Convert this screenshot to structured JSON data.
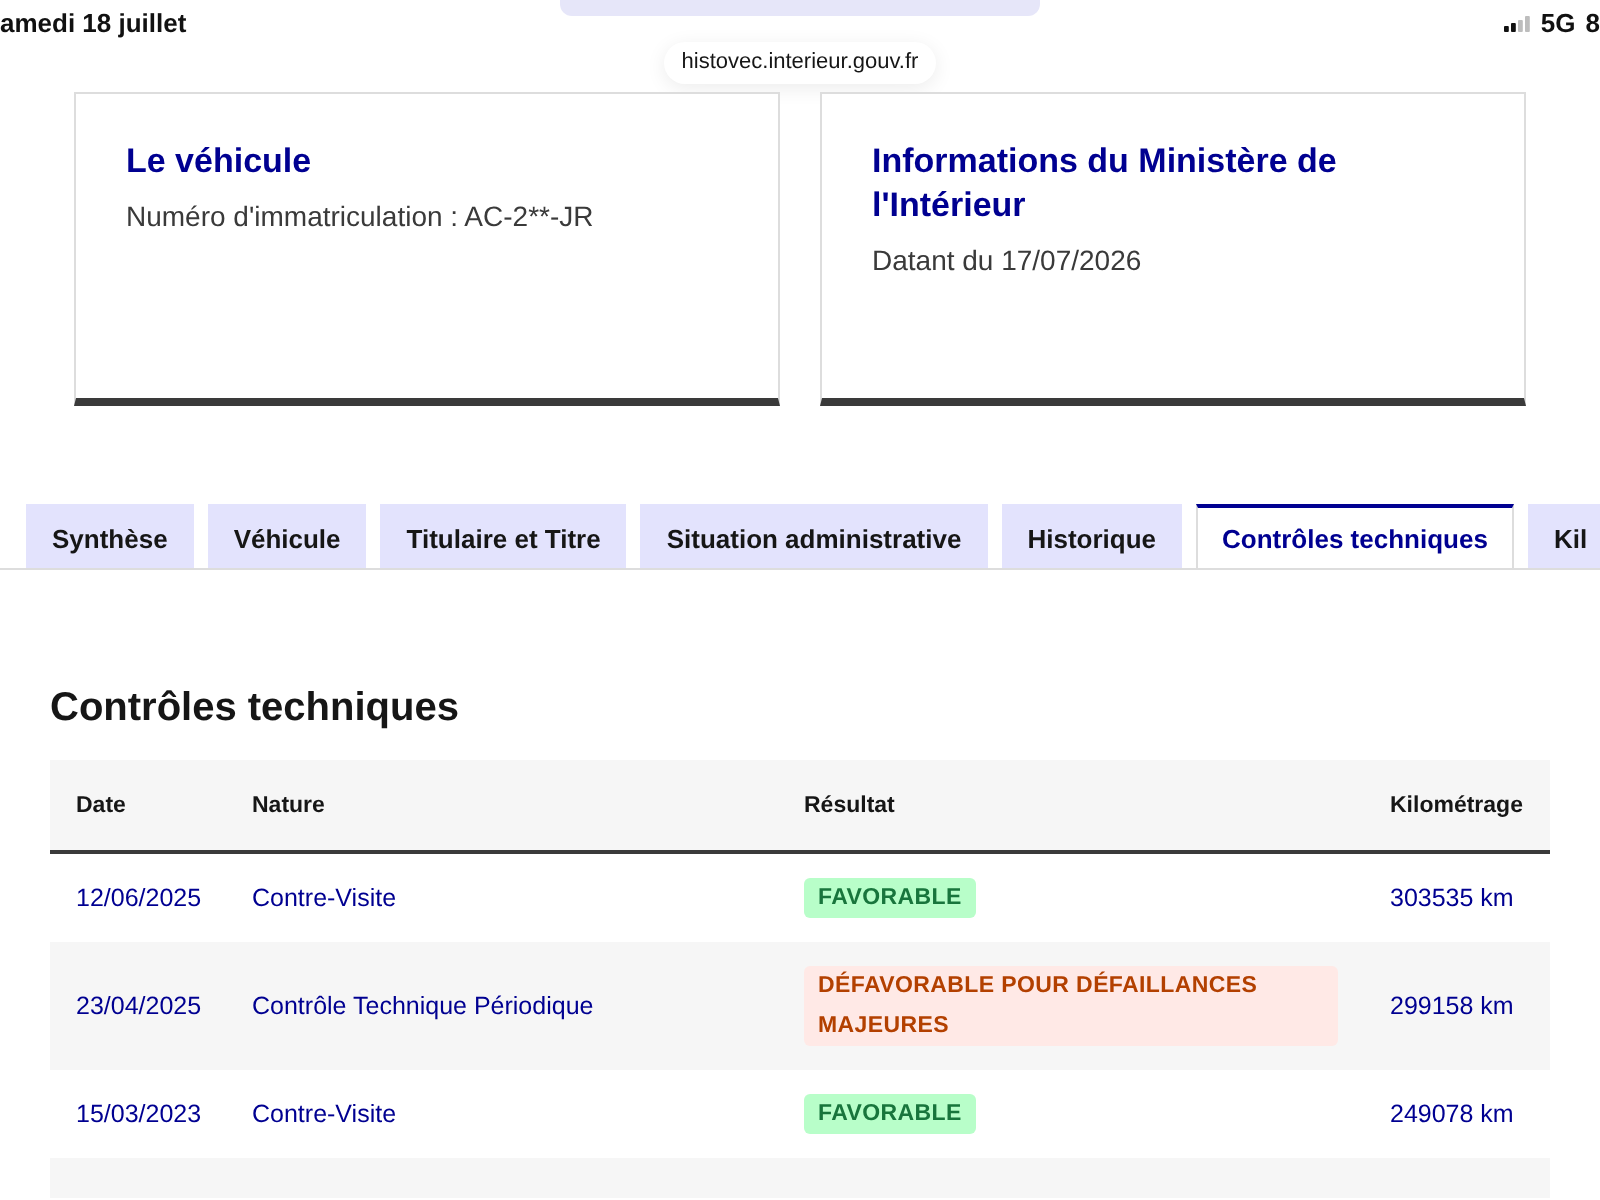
{
  "status_bar": {
    "date": "amedi 18 juillet",
    "network": "5G",
    "battery": "8"
  },
  "address_bar": {
    "url": "histovec.interieur.gouv.fr"
  },
  "cards": [
    {
      "title": "Le véhicule",
      "text": "Numéro d'immatriculation : AC-2**-JR"
    },
    {
      "title": "Informations du Ministère de l'Intérieur",
      "text": "Datant du 17/07/2026"
    }
  ],
  "tabs": [
    {
      "label": "Synthèse",
      "selected": false
    },
    {
      "label": "Véhicule",
      "selected": false
    },
    {
      "label": "Titulaire et Titre",
      "selected": false
    },
    {
      "label": "Situation administrative",
      "selected": false
    },
    {
      "label": "Historique",
      "selected": false
    },
    {
      "label": "Contrôles techniques",
      "selected": true
    },
    {
      "label": "Kil",
      "selected": false
    }
  ],
  "panel": {
    "title": "Contrôles techniques"
  },
  "table": {
    "columns": [
      "Date",
      "Nature",
      "Résultat",
      "Kilométrage"
    ],
    "rows": [
      {
        "date": "12/06/2025",
        "nature": "Contre-Visite",
        "result": {
          "label": "FAVORABLE",
          "kind": "success"
        },
        "mileage": "303535 km"
      },
      {
        "date": "23/04/2025",
        "nature": "Contrôle Technique Périodique",
        "result": {
          "label": "DÉFAVORABLE POUR DÉFAILLANCES MAJEURES",
          "kind": "warning"
        },
        "mileage": "299158 km"
      },
      {
        "date": "15/03/2023",
        "nature": "Contre-Visite",
        "result": {
          "label": "FAVORABLE",
          "kind": "success"
        },
        "mileage": "249078 km"
      }
    ]
  }
}
